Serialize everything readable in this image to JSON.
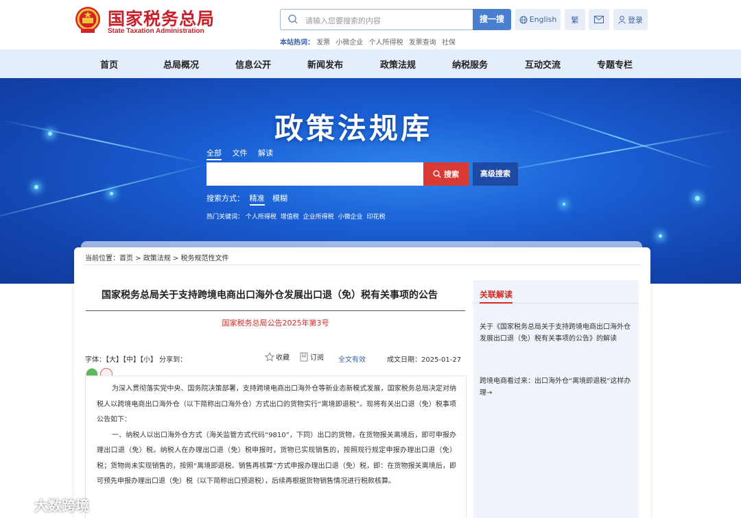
{
  "header": {
    "site_name_cn": "国家税务总局",
    "site_name_en": "State Taxation Administration",
    "search_placeholder": "请输入您要搜索的内容",
    "search_button": "搜一搜",
    "english_button": "English",
    "traditional_button": "繁",
    "login_button": "登录",
    "hot_label": "本站热词：",
    "hot_words": [
      "发票",
      "小微企业",
      "个人所得税",
      "发票查询",
      "社保"
    ]
  },
  "nav": {
    "items": [
      "首页",
      "总局概况",
      "信息公开",
      "新闻发布",
      "政策法规",
      "纳税服务",
      "互动交流",
      "专题专栏"
    ]
  },
  "banner": {
    "title": "政策法规库",
    "tabs": [
      "全部",
      "文件",
      "解读"
    ],
    "search_button": "搜索",
    "advanced_button": "高级搜索",
    "mode_label": "搜索方式：",
    "mode_precise": "精准",
    "mode_fuzzy": "模糊",
    "hot_label": "热门关键词：",
    "hot_words": [
      "个人所得税",
      "增值税",
      "企业所得税",
      "小微企业",
      "印花税"
    ]
  },
  "breadcrumb": "当前位置：首页 > 政策法规 > 税务规范性文件",
  "article": {
    "title": "国家税务总局关于支持跨境电商出口海外仓发展出口退（免）税有关事项的公告",
    "doc_number": "国家税务总局公告2025年第3号",
    "font_label": "字体：【大】【中】【小】 分享到：",
    "favorite": "收藏",
    "subscribe": "订阅",
    "validity": "全文有效",
    "date": "成文日期：2025-01-27",
    "paragraphs": [
      "为深入贯彻落实党中央、国务院决策部署，支持跨境电商出口海外仓等新业态新模式发展，国家税务总局决定对纳税人以跨境电商出口海外仓（以下简称出口海外仓）方式出口的货物实行“离境即退税”。现将有关出口退（免）税事项公告如下：",
      "一、纳税人以出口海外仓方式（海关监管方式代码“9810”，下同）出口的货物，在货物报关离境后，即可申报办理出口退（免）税。纳税人在办理出口退（免）税申报时，货物已实现销售的，按照现行规定申报办理出口退（免）税；货物尚未实现销售的，按照“离境即退税、销售再核算”方式申报办理出口退（免）税，即：在货物报关离境后，即可预先申报办理出口退（免）税（以下简称出口预退税），后续再根据货物销售情况进行税款核算。"
    ]
  },
  "sidebar": {
    "heading": "关联解读",
    "items": [
      "关于《国家税务总局关于支持跨境电商出口海外仓发展出口退（免）税有关事项的公告》的解读",
      "跨境电商看过来：出口海外仓“离境即退税”这样办理→"
    ]
  },
  "watermark": "大数跨境"
}
